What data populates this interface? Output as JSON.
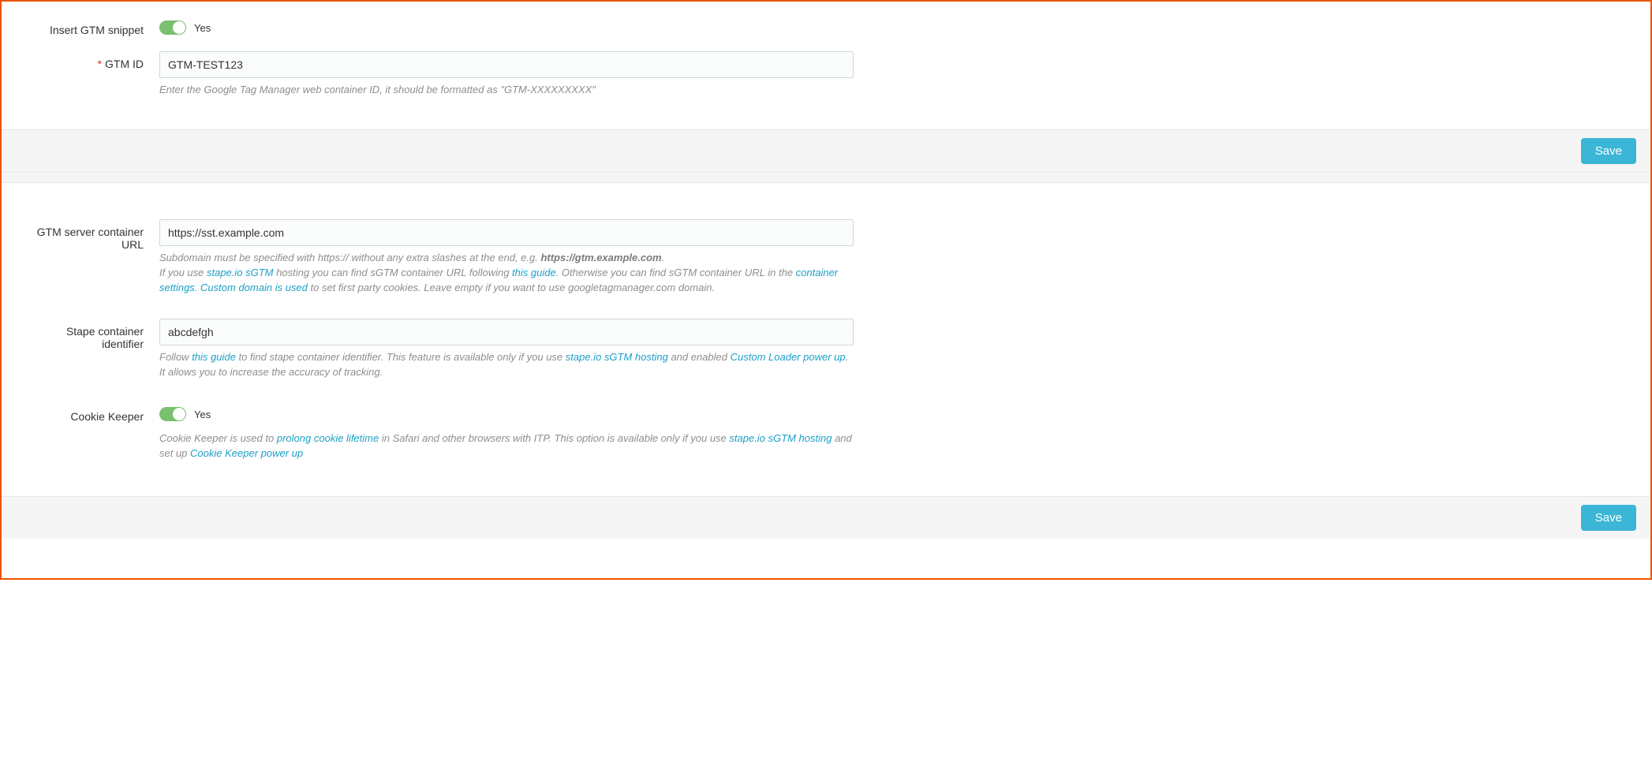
{
  "section1": {
    "insert_snippet": {
      "label": "Insert GTM snippet",
      "state_label": "Yes"
    },
    "gtm_id": {
      "label": "GTM ID",
      "required": true,
      "value": "GTM-TEST123",
      "help": "Enter the Google Tag Manager web container ID, it should be formatted as \"GTM-XXXXXXXXX\""
    },
    "save_label": "Save"
  },
  "section2": {
    "server_url": {
      "label": "GTM server container URL",
      "value": "https://sst.example.com",
      "help": {
        "l1_pre": "Subdomain must be specified with https:// without any extra slashes at the end, e.g. ",
        "l1_bold": "https://gtm.example.com",
        "l1_post": ".",
        "l2_pre": "If you use ",
        "l2_link1": "stape.io sGTM",
        "l2_mid1": " hosting you can find sGTM container URL following ",
        "l2_link2": "this guide",
        "l2_mid2": ". Otherwise you can find sGTM container URL in the ",
        "l2_link3": "container settings",
        "l2_mid3": ". ",
        "l2_link4": "Custom domain is used",
        "l2_post": " to set first party cookies. Leave empty if you want to use googletagmanager.com domain."
      }
    },
    "stape_id": {
      "label": "Stape container identifier",
      "value": "abcdefgh",
      "help": {
        "pre": "Follow ",
        "link1": "this guide",
        "mid1": " to find stape container identifier. This feature is available only if you use ",
        "link2": "stape.io sGTM hosting",
        "mid2": " and enabled ",
        "link3": "Custom Loader power up",
        "post": ". It allows you to increase the accuracy of tracking."
      }
    },
    "cookie_keeper": {
      "label": "Cookie Keeper",
      "state_label": "Yes",
      "help": {
        "pre": "Cookie Keeper is used to ",
        "link1": "prolong cookie lifetime",
        "mid1": " in Safari and other browsers with ITP. This option is available only if you use ",
        "link2": "stape.io sGTM hosting",
        "mid2": " and set up ",
        "link3": "Cookie Keeper power up",
        "post": ""
      }
    },
    "save_label": "Save"
  }
}
